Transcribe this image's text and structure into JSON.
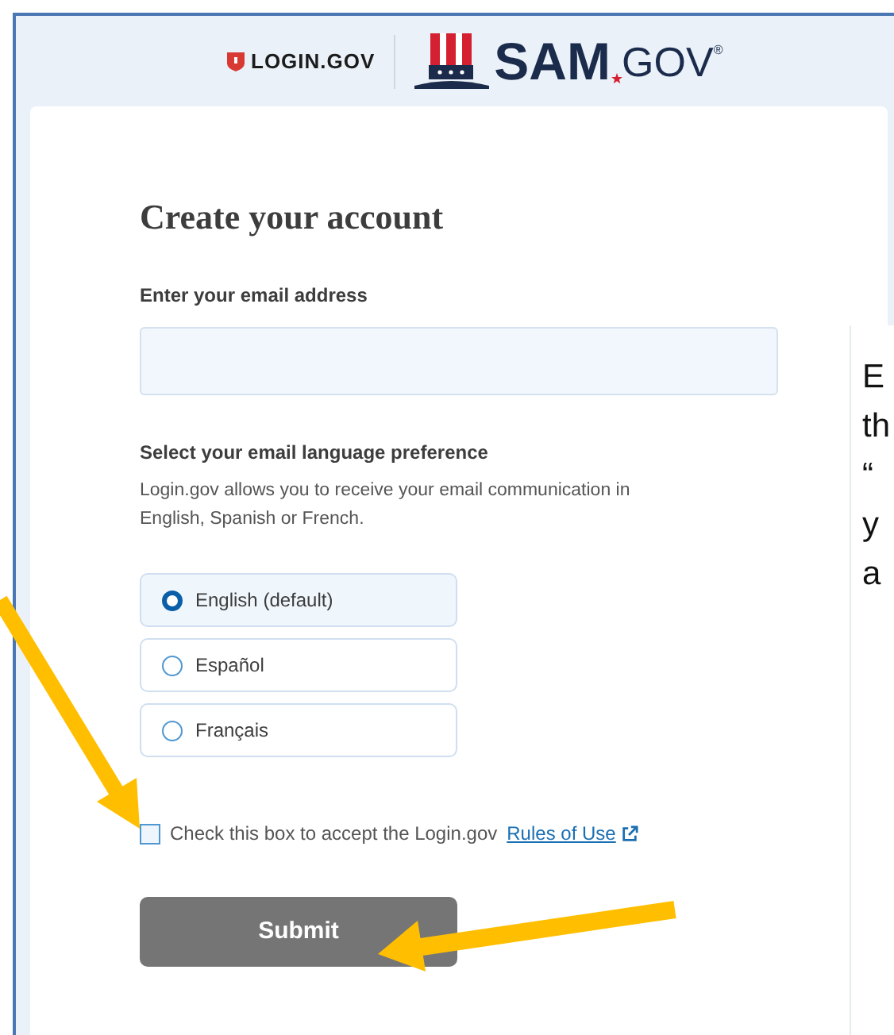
{
  "login_logo": {
    "text": "LOGIN.GOV"
  },
  "sam_logo": {
    "text": "SAM",
    "suffix": "GOV",
    "mark": "®"
  },
  "form": {
    "title": "Create your account",
    "email_label": "Enter your email address",
    "language_label": "Select your email language preference",
    "language_help": "Login.gov allows you to receive your email communication in English, Spanish or French.",
    "languages": [
      {
        "label": "English (default)",
        "selected": true
      },
      {
        "label": "Español",
        "selected": false
      },
      {
        "label": "Français",
        "selected": false
      }
    ],
    "terms": {
      "text": "Check this box to accept the Login.gov",
      "link": "Rules of Use",
      "checked": false
    },
    "submit": "Submit"
  },
  "side_note": {
    "lines": [
      "E",
      "th",
      "“",
      "y",
      "a"
    ]
  }
}
